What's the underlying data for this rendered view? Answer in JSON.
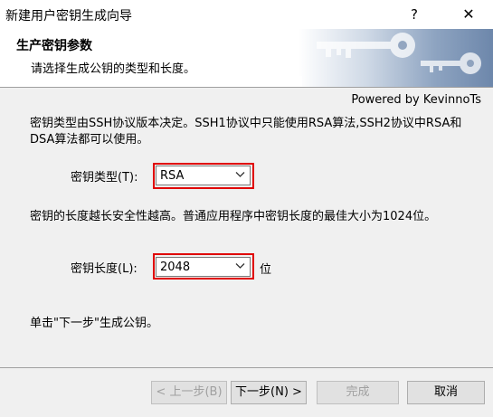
{
  "window": {
    "title": "新建用户密钥生成向导",
    "help_label": "?",
    "close_label": "✕"
  },
  "header": {
    "title": "生产密钥参数",
    "subtitle": "请选择生成公钥的类型和长度。"
  },
  "powered_by": "Powered by KevinnoTs",
  "description_type": "密钥类型由SSH协议版本决定。SSH1协议中只能使用RSA算法,SSH2协议中RSA和DSA算法都可以使用。",
  "key_type": {
    "label": "密钥类型(T):",
    "value": "RSA"
  },
  "description_length": "密钥的长度越长安全性越高。普通应用程序中密钥长度的最佳大小为1024位。",
  "key_length": {
    "label": "密钥长度(L):",
    "value": "2048",
    "unit": "位"
  },
  "instruction": "单击\"下一步\"生成公钥。",
  "buttons": {
    "back": "< 上一步(B)",
    "next": "下一步(N) >",
    "finish": "完成",
    "cancel": "取消"
  },
  "colors": {
    "highlight": "#e00000"
  },
  "icons": {
    "dropdown": "chevron-down-icon",
    "header_graphic": "keys-graphic"
  }
}
